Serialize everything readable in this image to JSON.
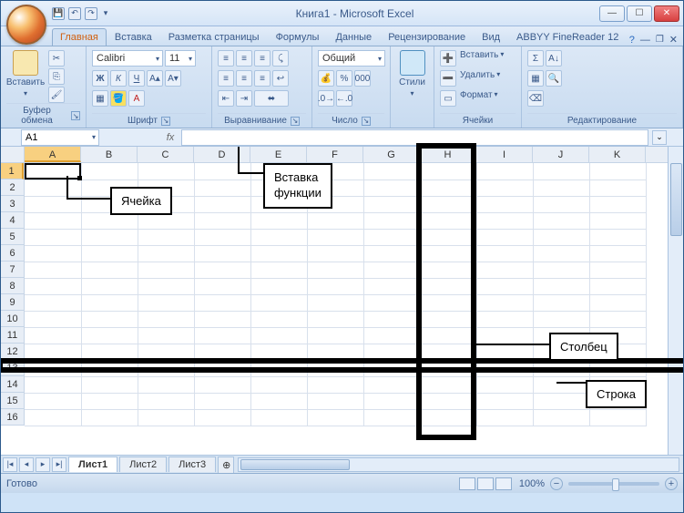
{
  "title": "Книга1 - Microsoft Excel",
  "tabs": {
    "t0": "Главная",
    "t1": "Вставка",
    "t2": "Разметка страницы",
    "t3": "Формулы",
    "t4": "Данные",
    "t5": "Рецензирование",
    "t6": "Вид",
    "t7": "ABBYY FineReader 12"
  },
  "ribbon": {
    "clipboard": {
      "label": "Буфер обмена",
      "paste": "Вставить"
    },
    "font": {
      "label": "Шрифт",
      "name": "Calibri",
      "size": "11"
    },
    "align": {
      "label": "Выравнивание"
    },
    "number": {
      "label": "Число",
      "format": "Общий"
    },
    "styles": {
      "label": "Стили",
      "btn": "Стили"
    },
    "cells": {
      "label": "Ячейки",
      "insert": "Вставить",
      "delete": "Удалить",
      "format": "Формат"
    },
    "editing": {
      "label": "Редактирование"
    }
  },
  "namebox": "A1",
  "fx": "fx",
  "columns": [
    "A",
    "B",
    "C",
    "D",
    "E",
    "F",
    "G",
    "H",
    "I",
    "J",
    "K"
  ],
  "rows": [
    "1",
    "2",
    "3",
    "4",
    "5",
    "6",
    "7",
    "8",
    "9",
    "10",
    "11",
    "12",
    "13",
    "14",
    "15",
    "16"
  ],
  "sheets": {
    "s1": "Лист1",
    "s2": "Лист2",
    "s3": "Лист3"
  },
  "status": {
    "ready": "Готово",
    "zoom": "100%"
  },
  "callouts": {
    "cell": "Ячейка",
    "func": "Вставка функции",
    "col": "Столбец",
    "row": "Строка"
  },
  "zoom": {
    "minus": "−",
    "plus": "+"
  }
}
